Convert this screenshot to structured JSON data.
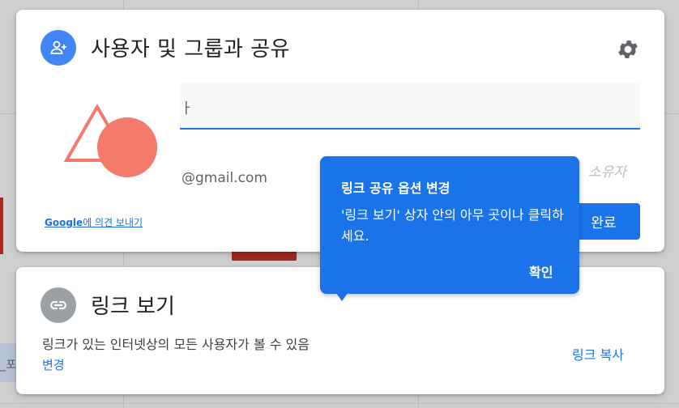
{
  "share": {
    "title": "사용자 및 그룹과 공유",
    "input_partial": "ㅏ",
    "input_placeholder": "",
    "email": "@gmail.com",
    "owner_label": "소유자",
    "feedback_brand": "Google",
    "feedback_text": "에 의견 보내기",
    "done_label": "완료"
  },
  "link": {
    "title": "링크 보기",
    "description": "링크가 있는 인터넷상의 모든 사용자가 볼 수 있음",
    "change_label": "변경",
    "copy_label": "링크 복사"
  },
  "tooltip": {
    "title": "링크 공유 옵션 변경",
    "body": "'링크 보기' 상자 안의 아무 곳이나 클릭하세요.",
    "confirm_label": "확인"
  },
  "colors": {
    "accent": "#1a73e8",
    "avatar_blue": "#4285f4",
    "link_gray": "#9aa0a6",
    "illustration": "#f47b6b"
  },
  "background": {
    "left_text": "_포"
  }
}
